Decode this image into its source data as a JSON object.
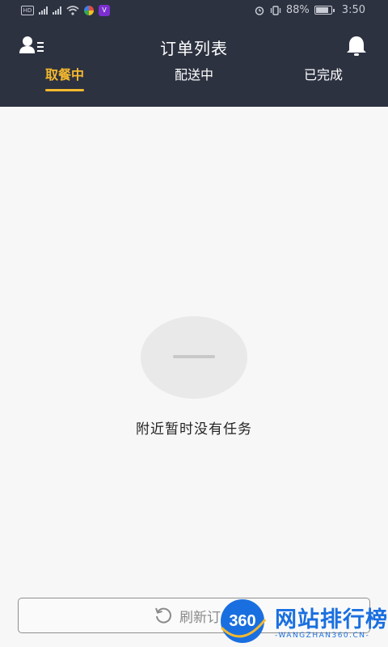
{
  "status_bar": {
    "battery_percent": "88%",
    "time": "3:50",
    "battery_level": 0.88
  },
  "header": {
    "title": "订单列表"
  },
  "tabs": [
    {
      "label": "取餐中",
      "active": true
    },
    {
      "label": "配送中",
      "active": false
    },
    {
      "label": "已完成",
      "active": false
    }
  ],
  "empty_state": {
    "message": "附近暂时没有任务"
  },
  "refresh_button": {
    "label": "刷新订单"
  },
  "watermark": {
    "brand": "网站排行榜",
    "sub": "-WANGZHAN360.CN-",
    "logo_number": "360"
  },
  "colors": {
    "header_bg": "#2d3241",
    "accent": "#f5b92e",
    "watermark_blue": "#1a6fe0"
  },
  "icons": {
    "menu": "user-list-icon",
    "bell": "bell-icon",
    "refresh": "refresh-icon"
  }
}
